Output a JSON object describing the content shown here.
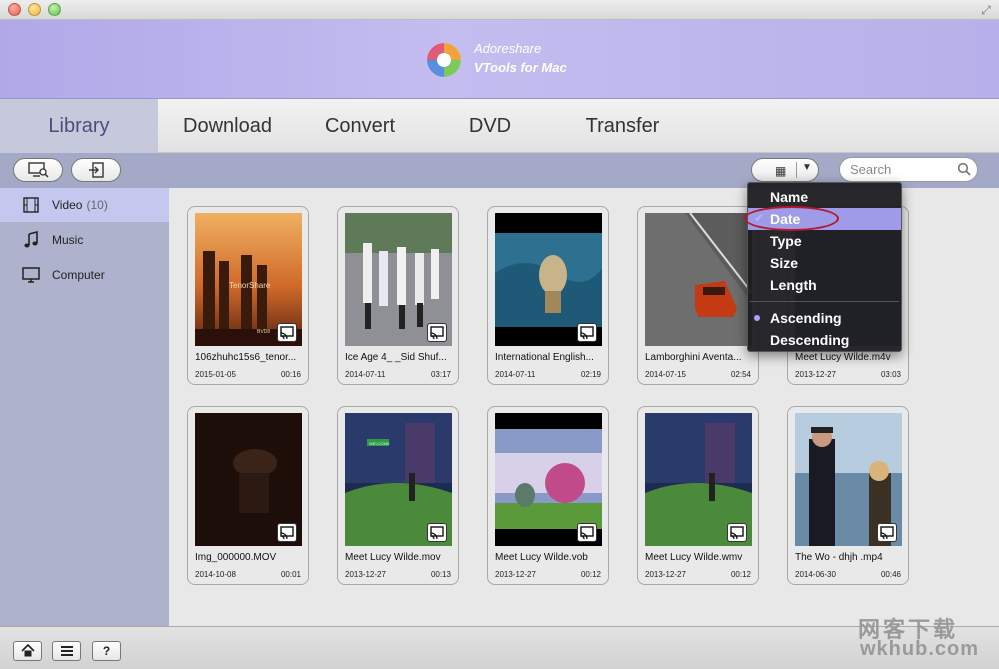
{
  "app": {
    "brand_line1": "Adoreshare",
    "brand_line2": "VTools for Mac",
    "colors": {
      "accent": "#c4c8ef",
      "banner": "#b7b0ea",
      "menu_highlight": "#9f9be8"
    }
  },
  "tabs": [
    {
      "label": "Library"
    },
    {
      "label": "Download"
    },
    {
      "label": "Convert"
    },
    {
      "label": "DVD"
    },
    {
      "label": "Transfer"
    }
  ],
  "toolbar": {
    "left_buttons": [
      "screen-search-icon",
      "import-icon"
    ],
    "view_button_icon": "grid-icon",
    "search_placeholder": "Search"
  },
  "sidebar": {
    "items": [
      {
        "label": "Video",
        "count": "(10)",
        "icon": "film-icon"
      },
      {
        "label": "Music",
        "count": "",
        "icon": "music-note-icon"
      },
      {
        "label": "Computer",
        "count": "",
        "icon": "monitor-icon"
      }
    ]
  },
  "videos": [
    {
      "title": "106zhuhc15s6_tenor...",
      "date": "2015-01-05",
      "duration": "00:16"
    },
    {
      "title": "Ice Age 4_ _Sid Shuf...",
      "date": "2014-07-11",
      "duration": "03:17"
    },
    {
      "title": "International English...",
      "date": "2014-07-11",
      "duration": "02:19"
    },
    {
      "title": "Lamborghini Aventa...",
      "date": "2014-07-15",
      "duration": "02:54"
    },
    {
      "title": "Meet Lucy Wilde.m4v",
      "date": "2013-12-27",
      "duration": "03:03"
    },
    {
      "title": "Img_000000.MOV",
      "date": "2014-10-08",
      "duration": "00:01"
    },
    {
      "title": "Meet Lucy Wilde.mov",
      "date": "2013-12-27",
      "duration": "00:13"
    },
    {
      "title": "Meet Lucy Wilde.vob",
      "date": "2013-12-27",
      "duration": "00:12"
    },
    {
      "title": "Meet Lucy Wilde.wmv",
      "date": "2013-12-27",
      "duration": "00:12"
    },
    {
      "title": "The Wo - dhjh .mp4",
      "date": "2014-06-30",
      "duration": "00:46"
    }
  ],
  "thumb_text": {
    "first_watermark": "TenorShare",
    "first_corner": "BVD8",
    "sign_text": "WELCOME"
  },
  "sort_menu": {
    "fields": [
      {
        "label": "Name",
        "checked": false
      },
      {
        "label": "Date",
        "checked": true
      },
      {
        "label": "Type",
        "checked": false
      },
      {
        "label": "Size",
        "checked": false
      },
      {
        "label": "Length",
        "checked": false
      }
    ],
    "orders": [
      {
        "label": "Ascending",
        "selected": true
      },
      {
        "label": "Descending",
        "selected": false
      }
    ]
  },
  "bottom_buttons": [
    "home-icon",
    "list-icon",
    "?"
  ],
  "watermark": {
    "line1": "网客下载",
    "line2": "wkhub.com"
  }
}
